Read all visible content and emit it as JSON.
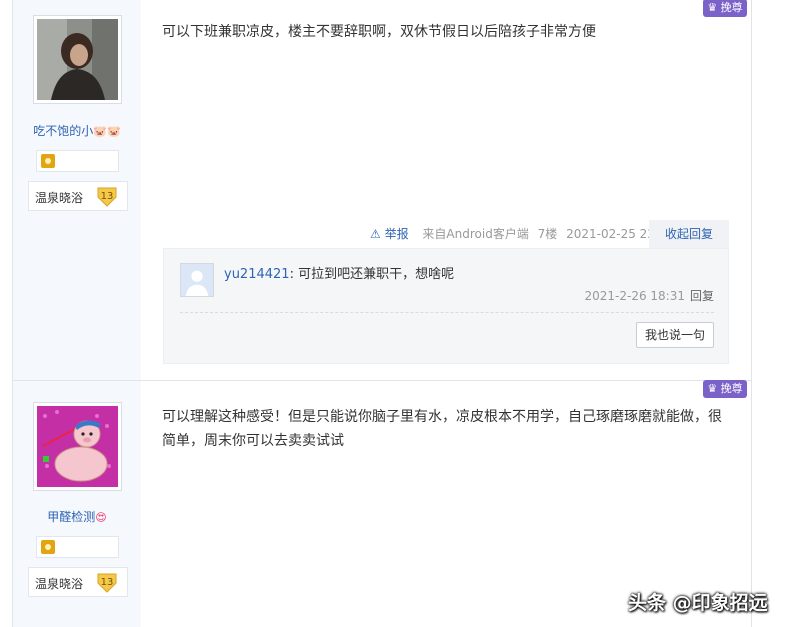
{
  "posts": [
    {
      "username": "吃不饱的小",
      "username_emoji": "🐷🐷",
      "level_title": "温泉晓浴",
      "level_num": "13",
      "tag_label": "挽尊",
      "content": "可以下班兼职凉皮，楼主不要辞职啊，双休节假日以后陪孩子非常方便",
      "report_label": "举报",
      "source": "来自Android客户端",
      "floor": "7楼",
      "time": "2021-02-25 22:55",
      "collapse_label": "收起回复",
      "subreply": {
        "user": "yu214421",
        "text": ": 可拉到吧还兼职干，想啥呢",
        "time": "2021-2-26 18:31",
        "reply_label": "回复"
      },
      "say_button": "我也说一句"
    },
    {
      "username": "甲醛检测",
      "username_emoji": "😍",
      "level_title": "温泉晓浴",
      "level_num": "13",
      "tag_label": "挽尊",
      "content": "可以理解这种感受！但是只能说你脑子里有水，凉皮根本不用学，自己琢磨琢磨就能做，很简单，周末你可以去卖卖试试"
    }
  ],
  "watermark": "头条 @印象招远",
  "colors": {
    "accent": "#2d64b3",
    "tag": "#7b62c9",
    "sidebar": "#f5f8fd"
  }
}
